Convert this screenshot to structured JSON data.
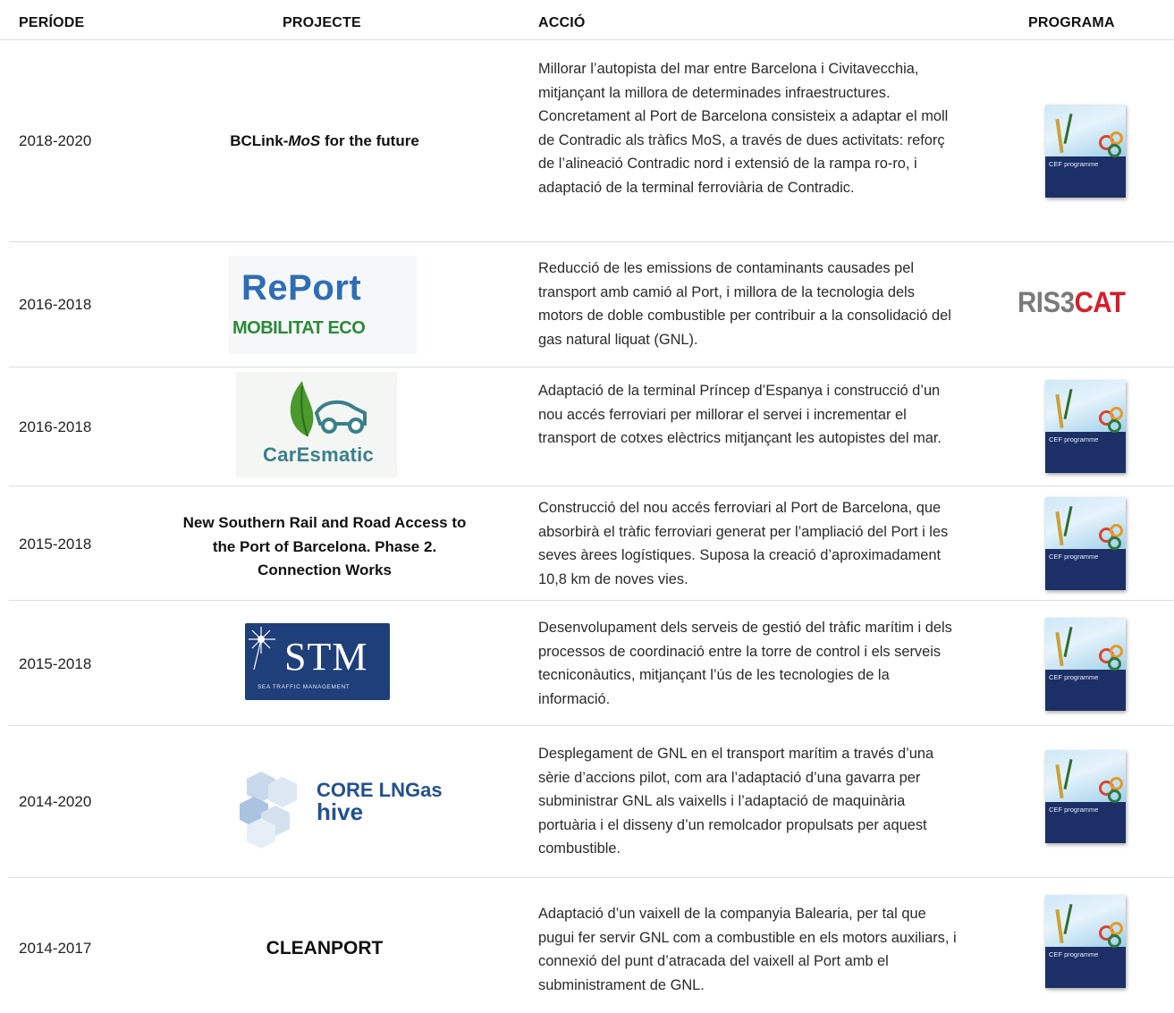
{
  "header": {
    "periode": "PERÍODE",
    "projecte": "PROJECTE",
    "accio": "ACCIÓ",
    "programa": "PROGRAMA"
  },
  "rows": [
    {
      "period": "2018-2020",
      "project_prefix": "BCLink-",
      "project_italic": "MoS",
      "project_suffix": " for the future",
      "action": "Millorar l’autopista del mar entre Barcelona i Civitavecchia, mitjançant la millora de determinades infraestructures. Concretament al Port de Barcelona consisteix a adaptar el moll de Contradic als tràfics MoS, a través de dues activitats: reforç de l’alineació Contradic nord i extensió de la rampa ro-ro, i adaptació de la terminal ferroviària de Contradic.",
      "programa": "CEF programme"
    },
    {
      "period": "2016-2018",
      "project_logo_line1": "RePort",
      "project_logo_line2": "MOBILITAT ECO",
      "action": "Reducció de les emissions de contaminants causades pel transport amb camió al Port, i millora de la tecnologia dels motors de doble combustible per contribuir a la consolidació del gas natural liquat (GNL).",
      "programa_a": "RIS3",
      "programa_b": "CAT"
    },
    {
      "period": "2016-2018",
      "project_logo": "CarEsmatic",
      "action": "Adaptació de la terminal Príncep d’Espanya i construcció d’un nou accés ferroviari per millorar el servei i incrementar el transport de cotxes elèctrics mitjançant les autopistes del mar.",
      "programa": "CEF programme"
    },
    {
      "period": "2015-2018",
      "project": "New Southern Rail and Road Access to the Port of Barcelona. Phase 2. Connection Works",
      "action": "Construcció del nou accés ferroviari al Port de Barcelona, que absorbirà el tràfic ferroviari generat per l’ampliació del Port i les seves àrees logístiques. Suposa la creació d’aproximadament 10,8 km de noves vies.",
      "programa": "CEF programme"
    },
    {
      "period": "2015-2018",
      "project_logo": "STM",
      "project_logo_sub": "SEA TRAFFIC MANAGEMENT",
      "action": "Desenvolupament dels serveis de gestió del tràfic marítim i dels processos de coordinació entre la torre de control i els serveis tecniconàutics, mitjançant l’ús de les tecnologies de la informació.",
      "programa": "CEF programme"
    },
    {
      "period": "2014-2020",
      "project_logo_line1": "CORE LNGas",
      "project_logo_line2": "hive",
      "action": "Desplegament de GNL en el transport marítim a través d’una sèrie d’accions pilot, com ara l’adaptació d’una gavarra per subministrar GNL als vaixells i l’adaptació de maquinària portuària i el disseny d’un remolcador propulsats per aquest combustible.",
      "programa": "CEF programme"
    },
    {
      "period": "2014-2017",
      "project": "CLEANPORT",
      "action": "Adaptació d’un vaixell de la companyia Balearia, per tal que pugui fer servir GNL com a combustible en els motors auxiliars, i connexió del punt d’atracada del vaixell al Port amb el subministrament de GNL.",
      "programa": "CEF programme"
    }
  ],
  "colors": {
    "report_blue": "#2f6db5",
    "report_green": "#2b8a3a",
    "caresmatic_teal": "#3a7f8a",
    "stm_navy": "#1f3f7a",
    "lngas_blue": "#23508f",
    "ris3_grey": "#7a7a7a",
    "ris3_red": "#d61d2a"
  }
}
